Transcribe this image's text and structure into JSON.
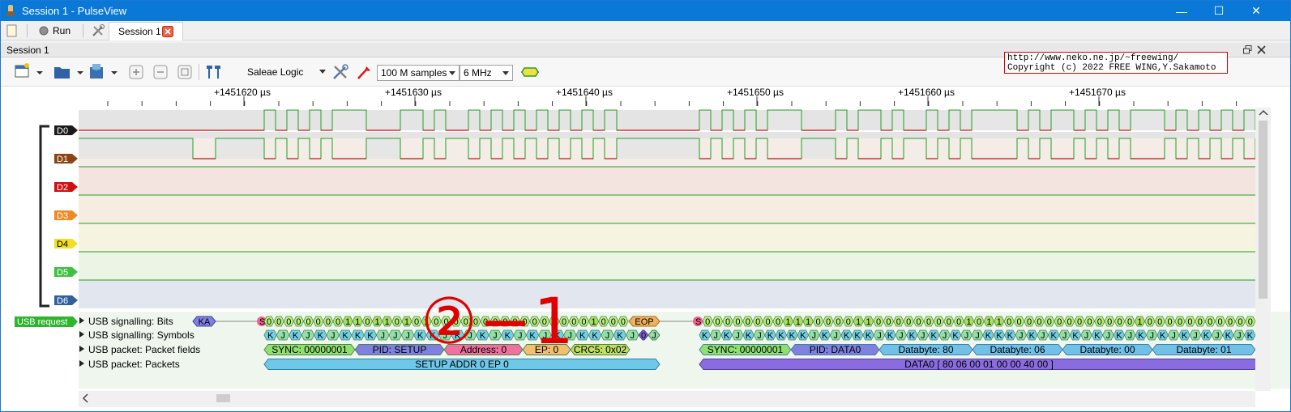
{
  "window": {
    "title": "Session 1 - PulseView",
    "minimize": "—",
    "maximize": "☐",
    "close": "✕"
  },
  "tabbar": {
    "run_label": "Run",
    "session_tab_label": "Session 1"
  },
  "dock": {
    "title": "Session 1"
  },
  "toolbar": {
    "device": "Saleae Logic",
    "samples": "100 M samples",
    "rate": "6 MHz"
  },
  "watermark": {
    "line1": "http://www.neko.ne.jp/~freewing/",
    "line2": "Copyright (c) 2022 FREE WING,Y.Sakamoto"
  },
  "ruler": {
    "ticks": [
      "+1451620 µs",
      "+1451630 µs",
      "+1451640 µs",
      "+1451650 µs",
      "+1451660 µs",
      "+1451670 µs"
    ]
  },
  "channels": [
    {
      "label": "D0",
      "color": "#1a1a1a"
    },
    {
      "label": "D1",
      "color": "#8b4513"
    },
    {
      "label": "D2",
      "color": "#d01010"
    },
    {
      "label": "D3",
      "color": "#f08a20"
    },
    {
      "label": "D4",
      "color": "#f0e020"
    },
    {
      "label": "D5",
      "color": "#40c040"
    },
    {
      "label": "D6",
      "color": "#3060a0"
    }
  ],
  "decoder": {
    "badge": "USB request",
    "rows": [
      "USB signalling: Bits",
      "USB signalling: Symbols",
      "USB packet: Packet fields",
      "USB packet: Packets"
    ],
    "bits_packet1": "0000000011011010100000000000000001000",
    "bits_packet2": "0000000011100001100000000010110000000000000100000000000",
    "symbols_packet1": "KJKJKJKKKJJJKKJKJKJKJKJKJKKJKJ",
    "symbols_packet2": "KJKJKJKKKKJKJKKKJKJKJKJKJJKKKJKJKJKJKJKJKJKJKJKJKJK",
    "ka": "KA",
    "eop": "EOP",
    "s": "S",
    "eop_j": "J",
    "fields1": [
      "SYNC: 00000001",
      "PID: SETUP",
      "Address: 0",
      "EP: 0",
      "CRC5: 0x02"
    ],
    "fields2": [
      "SYNC: 00000001",
      "PID: DATA0",
      "Databyte: 80",
      "Databyte: 06",
      "Databyte: 00",
      "Databyte: 01"
    ],
    "packet1": "SETUP ADDR 0 EP 0",
    "packet2": "DATA0 [ 80 06 00 01 00 00 40 00 ]"
  },
  "annotation": "②−1",
  "signals": {
    "d0_edges": [
      325,
      339,
      353,
      367,
      381,
      395,
      409,
      451,
      493,
      521,
      535,
      549,
      577,
      591,
      605,
      619,
      633,
      647,
      661,
      675,
      689,
      703,
      717,
      731,
      745,
      760,
      862,
      876,
      890,
      904,
      918,
      932,
      946,
      988,
      1030,
      1044,
      1058,
      1086,
      1100,
      1114,
      1142,
      1156,
      1170,
      1184,
      1198,
      1254,
      1268,
      1282,
      1296,
      1324,
      1338,
      1352,
      1366,
      1380,
      1394,
      1436,
      1450,
      1464,
      1478,
      1492,
      1506,
      1520,
      1534,
      1548
    ],
    "d0_start_high": false,
    "d1_edges": [
      237,
      265,
      325,
      339,
      353,
      367,
      381,
      395,
      409,
      451,
      493,
      521,
      535,
      549,
      577,
      591,
      605,
      619,
      633,
      647,
      661,
      675,
      689,
      703,
      717,
      731,
      745,
      760,
      862,
      876,
      890,
      904,
      918,
      932,
      946,
      988,
      1030,
      1044,
      1058,
      1086,
      1100,
      1114,
      1142,
      1156,
      1170,
      1184,
      1198,
      1254,
      1268,
      1282,
      1296,
      1324,
      1338,
      1352,
      1366,
      1380,
      1394,
      1436,
      1450,
      1464,
      1478,
      1492,
      1506,
      1520,
      1534,
      1548
    ],
    "d1_start_high": true
  },
  "colors": {
    "accent": "#0a78d7",
    "annotation_red": "#e00000",
    "wave_high": "#20a020",
    "wave_low": "#c01010"
  }
}
